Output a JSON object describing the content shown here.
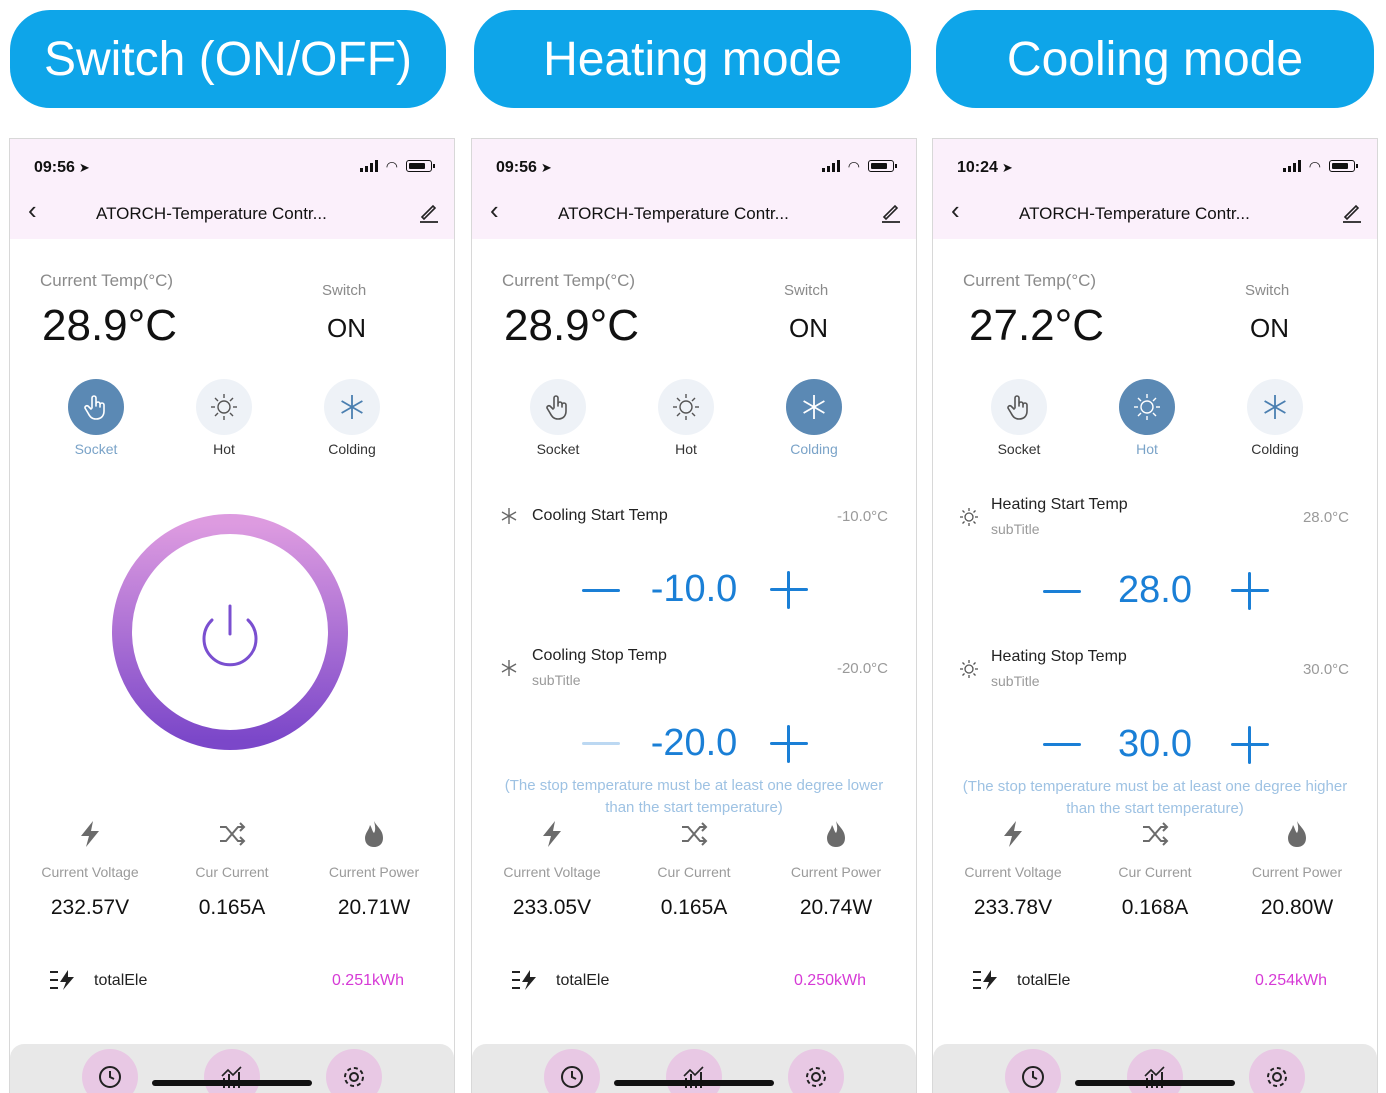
{
  "banners": [
    "Switch (ON/OFF)",
    "Heating mode",
    "Cooling mode"
  ],
  "colors": {
    "accent_blue": "#1a7fd6",
    "banner_blue": "#0ea5e9",
    "header_pink": "#fbf0fb",
    "energy_magenta": "#d63ad6",
    "active_mode": "#5b89b4"
  },
  "common": {
    "title": "ATORCH-Temperature Contr...",
    "current_temp_label": "Current Temp(°C)",
    "switch_label": "Switch",
    "modes": [
      "Socket",
      "Hot",
      "Colding"
    ],
    "meter_labels": [
      "Current Voltage",
      "Cur Current",
      "Current Power"
    ],
    "total_label": "totalEle",
    "subtitle": "subTitle",
    "icons": {
      "back": "chevron-left-icon",
      "edit": "edit-icon",
      "modes": [
        "hand-pointer-icon",
        "sun-icon",
        "snowflake-icon"
      ],
      "meters": [
        "lightning-icon",
        "shuffle-icon",
        "flame-icon"
      ],
      "tabs": [
        "clock-icon",
        "chart-icon",
        "gear-icon"
      ]
    }
  },
  "screens": [
    {
      "time": "09:56",
      "current_temp": "28.9°C",
      "switch_value": "ON",
      "active_mode": "Socket",
      "meters": [
        "232.57V",
        "0.165A",
        "20.71W"
      ],
      "total_value": "0.251kWh"
    },
    {
      "time": "09:56",
      "current_temp": "28.9°C",
      "switch_value": "ON",
      "active_mode": "Colding",
      "start_title": "Cooling Start Temp",
      "start_value": "-10.0°C",
      "start_stepper": "-10.0",
      "stop_title": "Cooling Stop Temp",
      "stop_value": "-20.0°C",
      "stop_stepper": "-20.0",
      "note_line1": "(The stop temperature must be at least one degree lower",
      "note_line2": "than the start temperature)",
      "meters": [
        "233.05V",
        "0.165A",
        "20.74W"
      ],
      "total_value": "0.250kWh"
    },
    {
      "time": "10:24",
      "current_temp": "27.2°C",
      "switch_value": "ON",
      "active_mode": "Hot",
      "start_title": "Heating Start Temp",
      "start_value": "28.0°C",
      "start_stepper": "28.0",
      "stop_title": "Heating Stop Temp",
      "stop_value": "30.0°C",
      "stop_stepper": "30.0",
      "note_line1": "(The stop temperature must be at least one degree higher",
      "note_line2": "than the start temperature)",
      "meters": [
        "233.78V",
        "0.168A",
        "20.80W"
      ],
      "total_value": "0.254kWh"
    }
  ]
}
